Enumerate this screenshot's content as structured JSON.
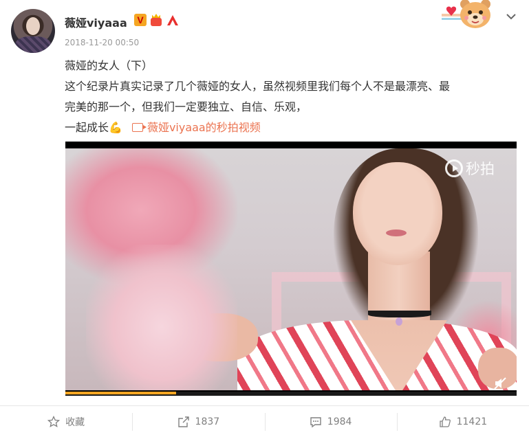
{
  "post": {
    "username": "薇娅viyaaa",
    "time": "2018-11-20 00:50",
    "lines": [
      "薇娅的女人（下）",
      "这个纪录片真实记录了几个薇娅的女人，虽然视频里我们每个人不是最漂亮、最",
      "完美的那一个，但我们一定要独立、自信、乐观，",
      "一起成长"
    ],
    "emoji": "💪",
    "video_link": "薇娅viyaaa的秒拍视频"
  },
  "video": {
    "watermark": "秒拍",
    "progress_fraction": 0.245
  },
  "actions": {
    "favorite": "收藏",
    "repost": "1837",
    "comment": "1984",
    "like": "11421"
  },
  "colors": {
    "link": "#eb7350",
    "progress": "#f5a623",
    "action_text": "#808080"
  }
}
